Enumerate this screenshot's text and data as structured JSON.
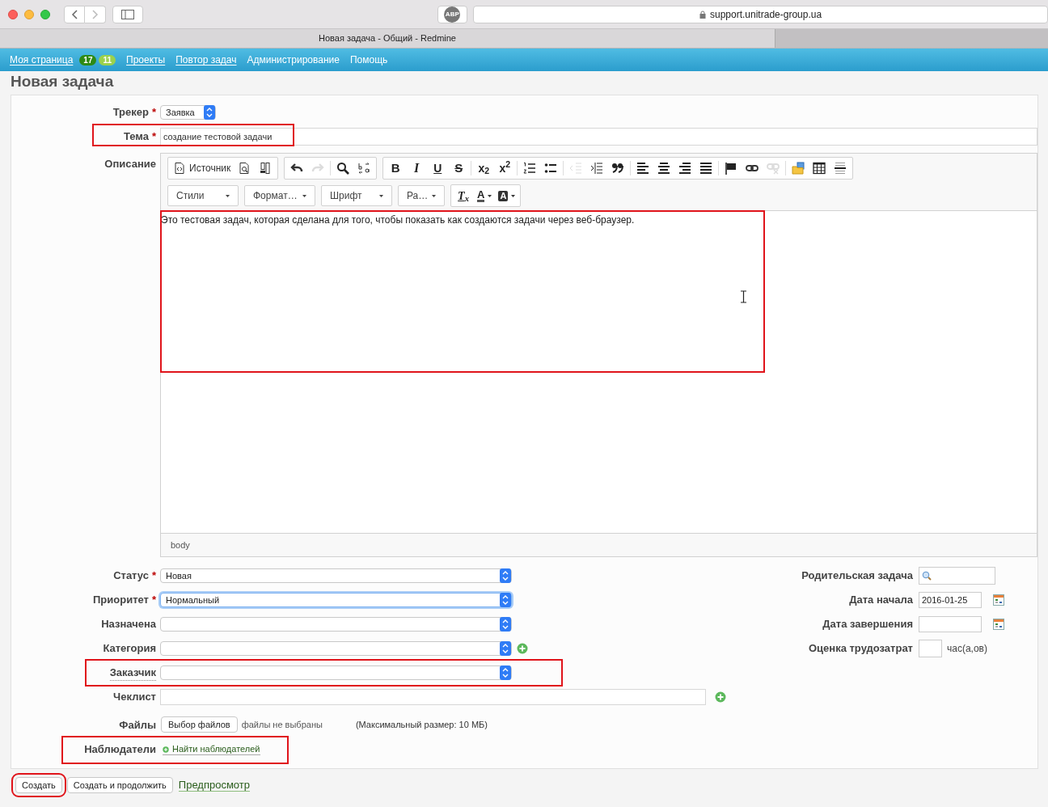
{
  "browser": {
    "adblock_label": "ABP",
    "address": "support.unitrade-group.ua",
    "tab_title": "Новая задача - Общий - Redmine"
  },
  "nav": [
    {
      "label": "Моя страница",
      "underlined": true,
      "badges": [
        {
          "text": "17",
          "color": "#2e8a14"
        },
        {
          "text": "11",
          "color": "#9bd14c"
        }
      ]
    },
    {
      "label": "Проекты",
      "underlined": true
    },
    {
      "label": "Повтор задач",
      "underlined": true
    },
    {
      "label": "Администрирование",
      "underlined": false
    },
    {
      "label": "Помощь",
      "underlined": false
    }
  ],
  "page_title": "Новая задача",
  "tracker": {
    "label": "Трекер",
    "required_mark": "*",
    "value": "Заявка"
  },
  "subject": {
    "label": "Тема",
    "required_mark": "*",
    "value": "создание тестовой задачи",
    "highlighted": true
  },
  "description": {
    "label": "Описание",
    "highlighted": true,
    "toolbar": [
      [
        {
          "clusters": [
            [
              {
                "kind": "source",
                "label": "Источник",
                "disabled": false
              },
              {
                "kind": "preview",
                "disabled": false
              },
              {
                "kind": "templates",
                "disabled": false
              }
            ]
          ]
        },
        {
          "clusters": [
            [
              {
                "kind": "undo",
                "disabled": false
              },
              {
                "kind": "redo",
                "disabled": true
              }
            ],
            [
              {
                "kind": "find",
                "disabled": false
              },
              {
                "kind": "replace",
                "disabled": false
              }
            ]
          ]
        },
        {
          "clusters": [
            [
              {
                "kind": "bold",
                "label": "B",
                "disabled": false
              },
              {
                "kind": "italic",
                "label": "I",
                "disabled": false
              },
              {
                "kind": "underline",
                "label": "U",
                "disabled": false
              },
              {
                "kind": "strike",
                "label": "S",
                "disabled": false
              }
            ],
            [
              {
                "kind": "subscript",
                "label": "x$_{2}$",
                "disabled": false
              },
              {
                "kind": "superscript",
                "label": "x$^{2}$",
                "disabled": false
              }
            ],
            [
              {
                "kind": "numbered",
                "disabled": false
              },
              {
                "kind": "bulleted",
                "disabled": false
              }
            ],
            [
              {
                "kind": "outdent",
                "disabled": true
              },
              {
                "kind": "indent",
                "disabled": false
              },
              {
                "kind": "quote",
                "disabled": false
              }
            ],
            [
              {
                "kind": "alignleft",
                "disabled": false
              },
              {
                "kind": "aligncenter",
                "disabled": false
              },
              {
                "kind": "alignright",
                "disabled": false
              },
              {
                "kind": "justify",
                "disabled": false
              }
            ],
            [
              {
                "kind": "flag",
                "disabled": false
              },
              {
                "kind": "link",
                "disabled": false
              },
              {
                "kind": "unlink",
                "disabled": true
              }
            ],
            [
              {
                "kind": "image",
                "disabled": false
              },
              {
                "kind": "table",
                "disabled": false
              },
              {
                "kind": "rule",
                "disabled": false
              }
            ]
          ]
        }
      ],
      [
        {
          "kind": "combo",
          "label": "Стили"
        },
        {
          "kind": "combo",
          "label": "Формат…"
        },
        {
          "kind": "combo",
          "label": "Шрифт"
        },
        {
          "kind": "combo",
          "label": "Ра…"
        },
        {
          "clusters": [
            [
              {
                "kind": "clearformat",
                "label": "T$_{x}$",
                "disabled": false
              },
              {
                "kind": "textcolor",
                "label": "A",
                "disabled": false
              },
              {
                "kind": "bgcolor",
                "label": "A",
                "disabled": false
              }
            ]
          ]
        }
      ]
    ],
    "text": "Это тестовая задач, которая сделана для того, чтобы показать как создаются задачи через веб-браузер.",
    "path": "body"
  },
  "left_fields": [
    {
      "kind": "select",
      "label": "Статус",
      "required_mark": "*",
      "value": "Новая"
    },
    {
      "kind": "select",
      "label": "Приоритет",
      "required_mark": "*",
      "value": "Нормальный",
      "focused": true
    },
    {
      "kind": "select",
      "label": "Назначена"
    },
    {
      "kind": "select",
      "label": "Категория",
      "add_button": true
    },
    {
      "kind": "select",
      "label": "Заказчик",
      "has_hint": true,
      "highlighted": true
    },
    {
      "kind": "text",
      "label": "Чеклист",
      "add_button": true
    },
    {
      "kind": "file",
      "label": "Файлы",
      "button": "Выбор файлов",
      "status": "файлы не выбраны",
      "note": "(Максимальный размер: 10 МБ)"
    },
    {
      "kind": "link",
      "label": "Наблюдатели",
      "value": "Найти наблюдателей",
      "highlighted": true
    }
  ],
  "right_fields": [
    {
      "kind": "search",
      "label": "Родительская задача"
    },
    {
      "kind": "date",
      "label": "Дата начала",
      "value": "2016-01-25"
    },
    {
      "kind": "date",
      "label": "Дата завершения"
    },
    {
      "kind": "hours",
      "label": "Оценка трудозатрат",
      "unit": "час(а,ов)"
    }
  ],
  "buttons": [
    {
      "kind": "button",
      "label": "Создать",
      "highlighted": true
    },
    {
      "kind": "button",
      "label": "Создать и продолжить"
    },
    {
      "kind": "link",
      "label": "Предпросмотр"
    }
  ]
}
